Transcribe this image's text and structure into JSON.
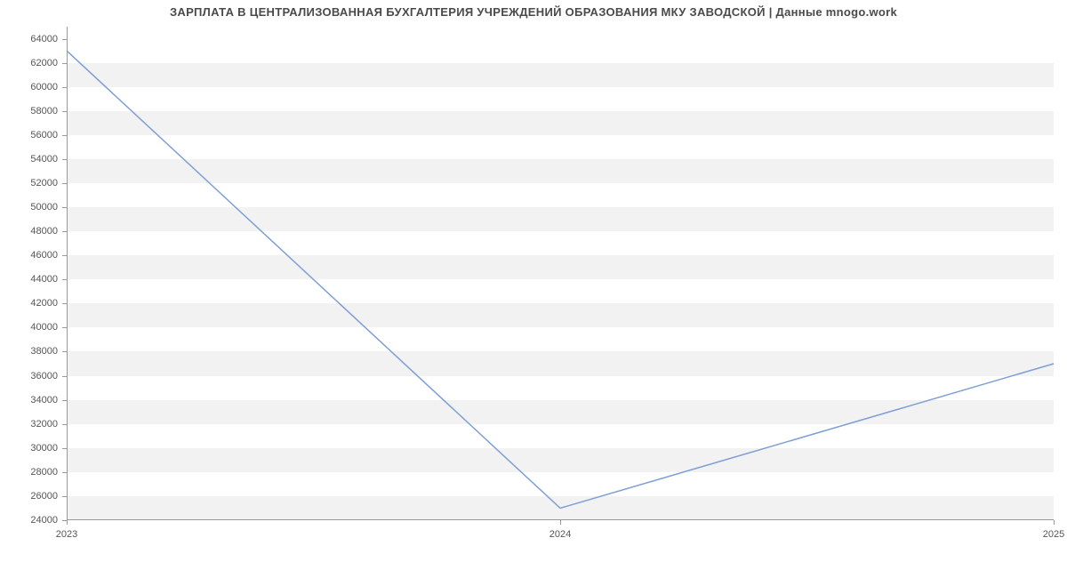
{
  "chart_data": {
    "type": "line",
    "title": "ЗАРПЛАТА В ЦЕНТРАЛИЗОВАННАЯ БУХГАЛТЕРИЯ УЧРЕЖДЕНИЙ ОБРАЗОВАНИЯ МКУ ЗАВОДСКОЙ | Данные mnogo.work",
    "x": [
      2023,
      2024,
      2025
    ],
    "values": [
      63000,
      25000,
      37000
    ],
    "x_ticks": [
      2023,
      2024,
      2025
    ],
    "y_ticks": [
      24000,
      26000,
      28000,
      30000,
      32000,
      34000,
      36000,
      38000,
      40000,
      42000,
      44000,
      46000,
      48000,
      50000,
      52000,
      54000,
      56000,
      58000,
      60000,
      62000,
      64000
    ],
    "xlim": [
      2023,
      2025
    ],
    "ylim": [
      24000,
      65000
    ],
    "xlabel": "",
    "ylabel": ""
  }
}
